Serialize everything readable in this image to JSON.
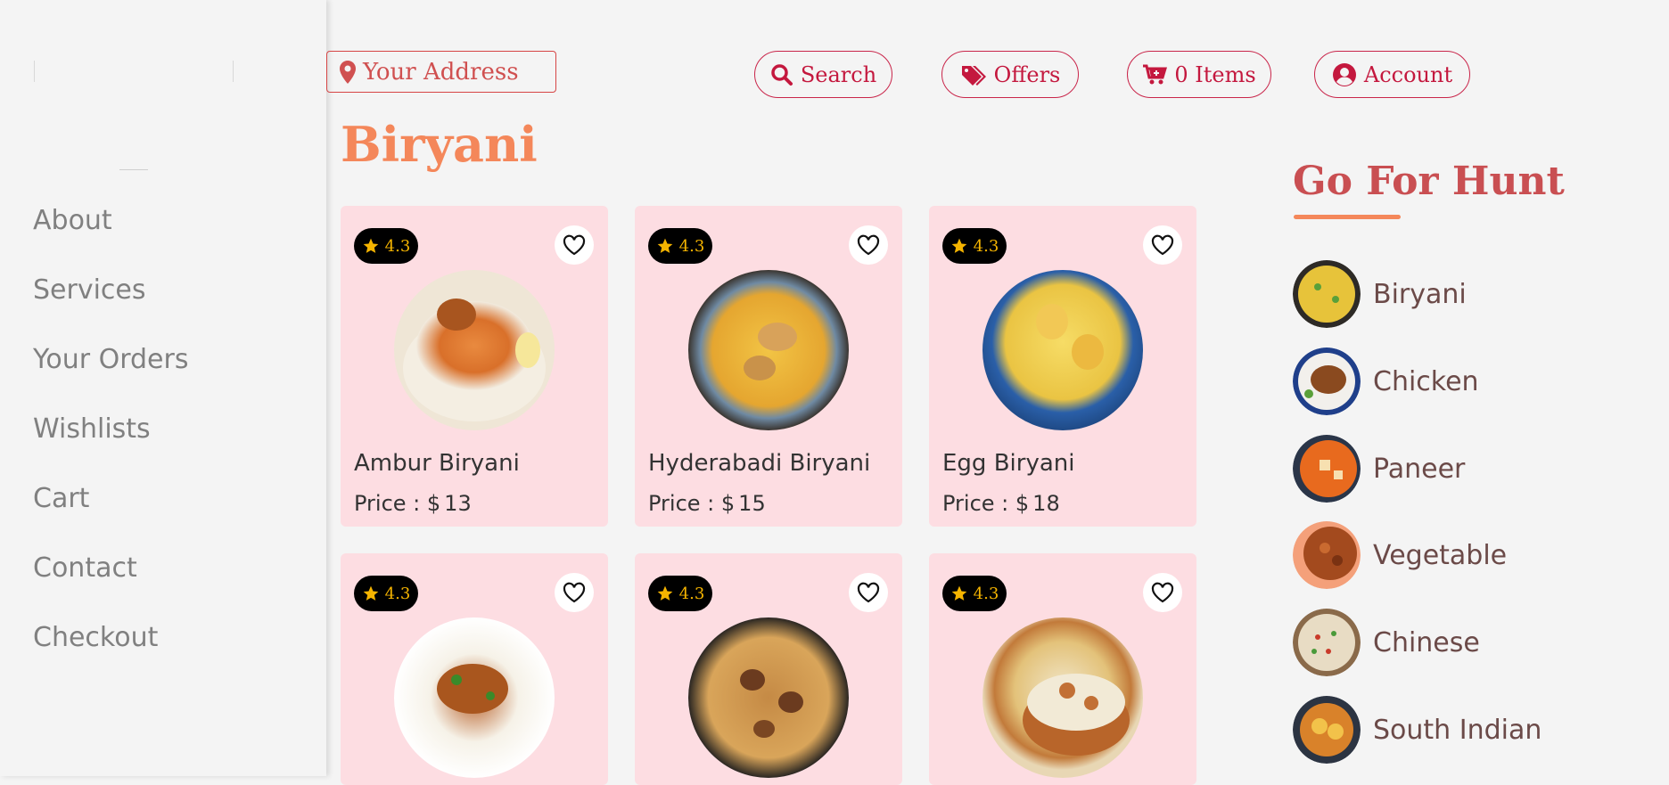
{
  "sidebar": {
    "items": [
      {
        "label": "About"
      },
      {
        "label": "Services"
      },
      {
        "label": "Your Orders"
      },
      {
        "label": "Wishlists"
      },
      {
        "label": "Cart"
      },
      {
        "label": "Contact"
      },
      {
        "label": "Checkout"
      }
    ]
  },
  "header": {
    "address_placeholder": "Your Address",
    "search_label": "Search",
    "offers_label": "Offers",
    "cart_label": "0 Items",
    "account_label": "Account"
  },
  "main": {
    "section_title": "Biryani",
    "price_prefix": "Price : $",
    "cards": [
      {
        "rating": "4.3",
        "name": "Ambur Biryani",
        "price": "13"
      },
      {
        "rating": "4.3",
        "name": "Hyderabadi Biryani",
        "price": "15"
      },
      {
        "rating": "4.3",
        "name": "Egg Biryani",
        "price": "18"
      },
      {
        "rating": "4.3",
        "name": "",
        "price": ""
      },
      {
        "rating": "4.3",
        "name": "",
        "price": ""
      },
      {
        "rating": "4.3",
        "name": "",
        "price": ""
      }
    ]
  },
  "categories": {
    "title": "Go For Hunt",
    "items": [
      {
        "label": "Biryani"
      },
      {
        "label": "Chicken"
      },
      {
        "label": "Paneer"
      },
      {
        "label": "Vegetable"
      },
      {
        "label": "Chinese"
      },
      {
        "label": "South Indian"
      }
    ]
  },
  "colors": {
    "accent": "#f4875a",
    "brand": "#c4183e",
    "card_bg": "#fddde2",
    "hunt_title": "#c94f52"
  }
}
